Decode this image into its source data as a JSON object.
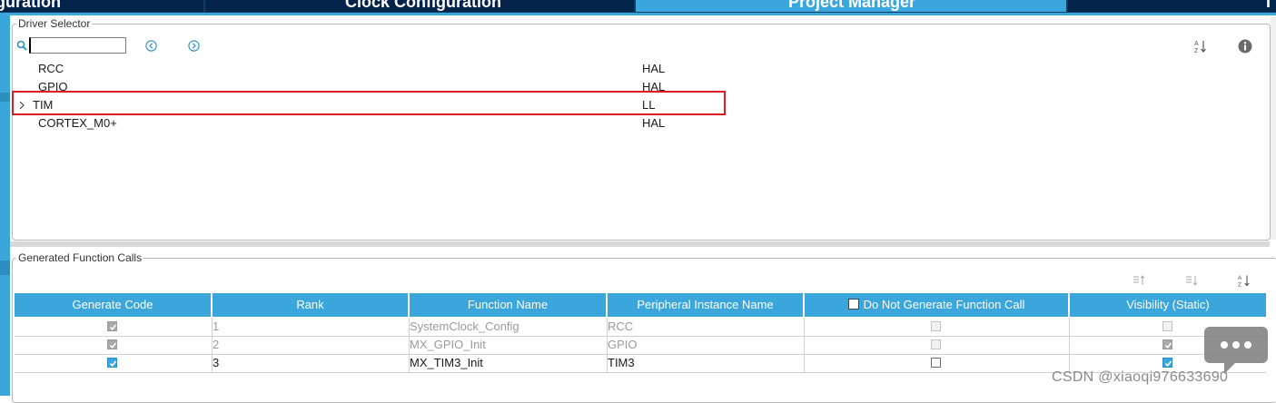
{
  "tabs": [
    {
      "label": "iguration"
    },
    {
      "label": "Clock Configuration"
    },
    {
      "label": "Project Manager"
    },
    {
      "label": "T"
    }
  ],
  "driver_selector": {
    "legend": "Driver Selector",
    "search": {
      "value": "",
      "placeholder": ""
    },
    "rows": [
      {
        "name": "RCC",
        "value": "HAL"
      },
      {
        "name": "GPIO",
        "value": "HAL"
      },
      {
        "name": "TIM",
        "value": "LL"
      },
      {
        "name": "CORTEX_M0+",
        "value": "HAL"
      }
    ]
  },
  "generated_calls": {
    "legend": "Generated Function Calls",
    "columns": [
      "Generate Code",
      "Rank",
      "Function Name",
      "Peripheral Instance Name",
      "Do Not Generate Function Call",
      "Visibility (Static)"
    ],
    "rows": [
      {
        "generate": true,
        "rank": "1",
        "function": "SystemClock_Config",
        "peripheral": "RCC",
        "do_not_generate": false,
        "visibility": false,
        "enabled": false
      },
      {
        "generate": true,
        "rank": "2",
        "function": "MX_GPIO_Init",
        "peripheral": "GPIO",
        "do_not_generate": false,
        "visibility": true,
        "enabled": false
      },
      {
        "generate": true,
        "rank": "3",
        "function": "MX_TIM3_Init",
        "peripheral": "TIM3",
        "do_not_generate": false,
        "visibility": true,
        "enabled": true
      }
    ]
  },
  "watermark": "CSDN @xiaoqi976633690",
  "colors": {
    "accent": "#3aa6dc",
    "tab_dark": "#03234b",
    "highlight": "#e01b24"
  }
}
